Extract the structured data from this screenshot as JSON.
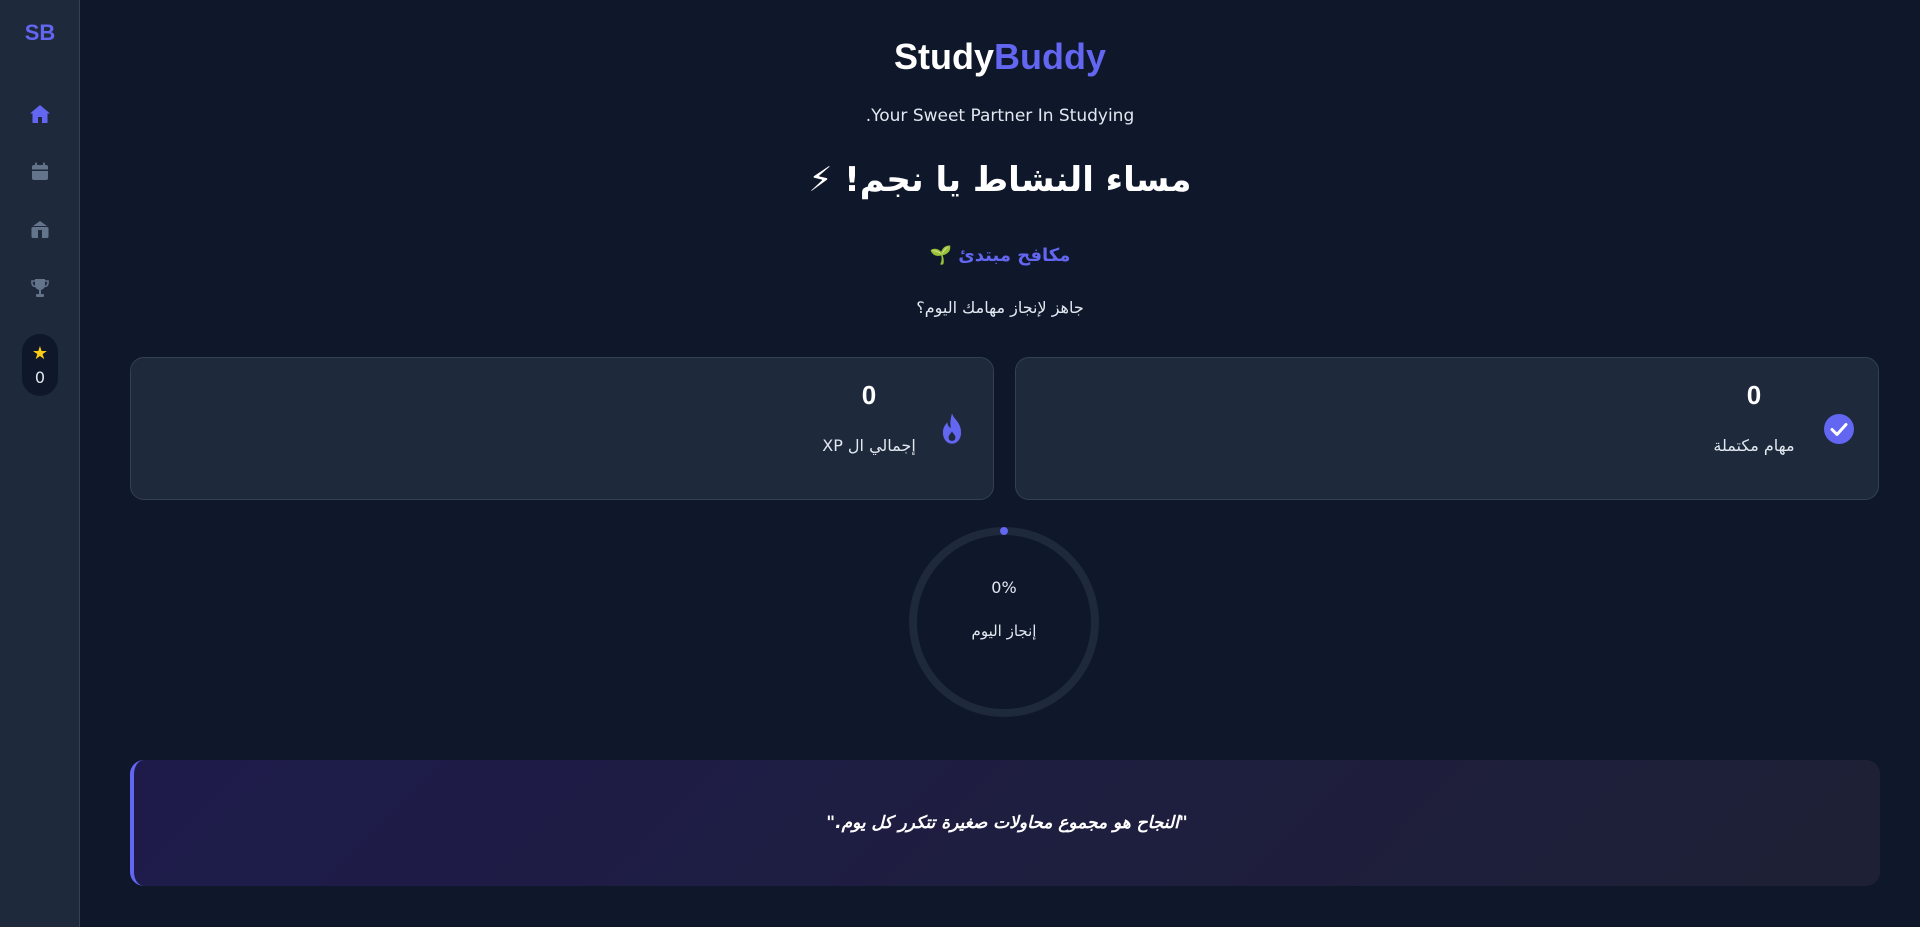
{
  "sidebar": {
    "logo": "SB",
    "nav": [
      {
        "icon": "home-icon",
        "active": true
      },
      {
        "icon": "calendar-icon",
        "active": false
      },
      {
        "icon": "shop-icon",
        "active": false
      },
      {
        "icon": "trophy-icon",
        "active": false
      }
    ],
    "xp_value": "0"
  },
  "header": {
    "brand_part1": "Study",
    "brand_part2": "Buddy",
    "tagline": "Your Sweet Partner In Studying.",
    "greeting": "مساء النشاط يا نجم! ⚡",
    "rank": "مكافح مبتدئ 🌱",
    "ready_text": "جاهز لإنجاز مهامك اليوم؟"
  },
  "stats": {
    "completed_tasks": {
      "value": "0",
      "label": "مهام مكتملة"
    },
    "total_xp": {
      "value": "0",
      "label": "إجمالي ال XP"
    }
  },
  "progress": {
    "percent_text": "0%",
    "fraction": 0,
    "label": "إنجاز اليوم"
  },
  "quote": "\"النجاح هو مجموع محاولات صغيرة تتكرر كل يوم.\"",
  "colors": {
    "accent": "#6366f1",
    "background": "#0f172a",
    "card": "#1e293b",
    "star": "#facc15"
  }
}
